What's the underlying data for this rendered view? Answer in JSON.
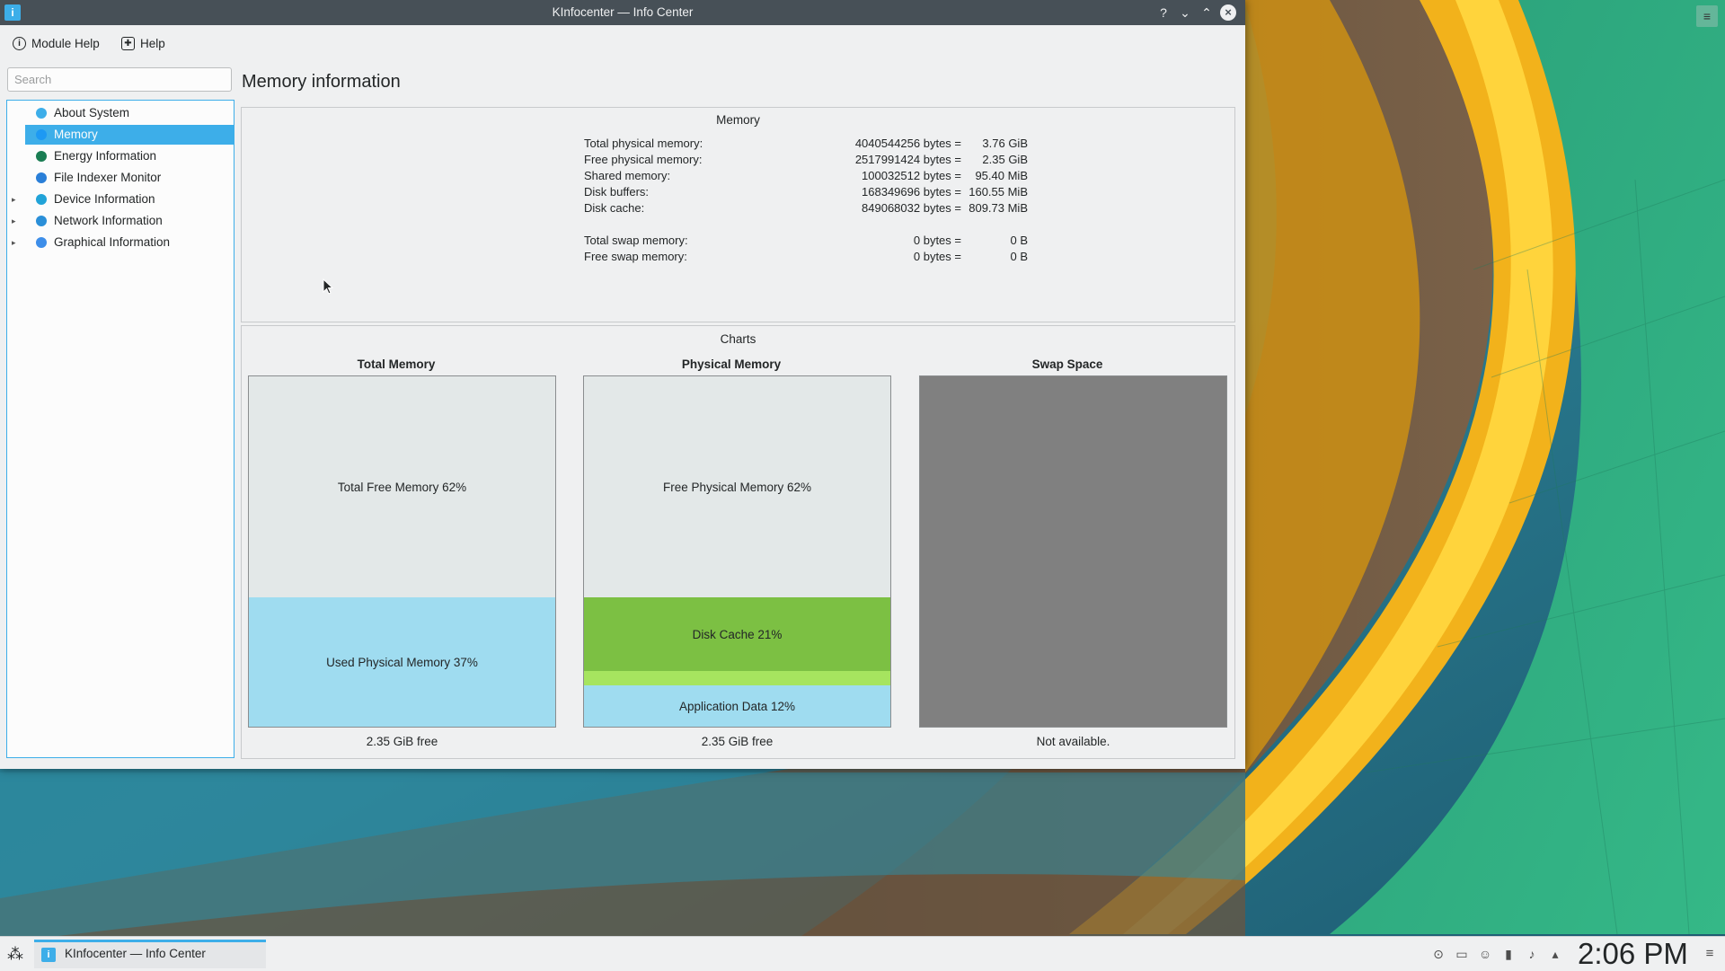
{
  "window": {
    "title": "KInfocenter — Info Center",
    "controls": {
      "help": "?",
      "minimize": "⌄",
      "maximize": "⌃",
      "close": "×"
    }
  },
  "toolbar": {
    "module_help_label": "Module Help",
    "help_label": "Help"
  },
  "sidebar": {
    "search_placeholder": "Search",
    "items": [
      {
        "label": "About System",
        "icon": "info-icon",
        "color": "#3daee9",
        "expandable": false,
        "selected": false
      },
      {
        "label": "Memory",
        "icon": "memory-icon",
        "color": "#1d99f3",
        "expandable": false,
        "selected": true
      },
      {
        "label": "Energy Information",
        "icon": "energy-icon",
        "color": "#1a7d53",
        "expandable": false,
        "selected": false
      },
      {
        "label": "File Indexer Monitor",
        "icon": "file-indexer-icon",
        "color": "#2a7fd8",
        "expandable": false,
        "selected": false
      },
      {
        "label": "Device Information",
        "icon": "device-icon",
        "color": "#21a3d8",
        "expandable": true,
        "selected": false
      },
      {
        "label": "Network Information",
        "icon": "network-icon",
        "color": "#2a8fd8",
        "expandable": true,
        "selected": false
      },
      {
        "label": "Graphical Information",
        "icon": "graphics-icon",
        "color": "#3d8ee9",
        "expandable": true,
        "selected": false
      }
    ]
  },
  "main": {
    "heading": "Memory information",
    "memory_group": {
      "title": "Memory",
      "rows": [
        {
          "label": "Total physical memory:",
          "bytes": "4040544256 bytes =",
          "human": "3.76 GiB"
        },
        {
          "label": "Free physical memory:",
          "bytes": "2517991424 bytes =",
          "human": "2.35 GiB"
        },
        {
          "label": "Shared memory:",
          "bytes": "100032512 bytes =",
          "human": "95.40 MiB"
        },
        {
          "label": "Disk buffers:",
          "bytes": "168349696 bytes =",
          "human": "160.55 MiB"
        },
        {
          "label": "Disk cache:",
          "bytes": "849068032 bytes =",
          "human": "809.73 MiB"
        }
      ],
      "swap_rows": [
        {
          "label": "Total swap memory:",
          "bytes": "0 bytes =",
          "human": "0 B"
        },
        {
          "label": "Free swap memory:",
          "bytes": "0 bytes =",
          "human": "0 B"
        }
      ]
    },
    "charts_group": {
      "title": "Charts",
      "charts": [
        {
          "title": "Total Memory",
          "caption": "2.35 GiB free",
          "segments": [
            {
              "label": "Total Free Memory 62%",
              "fraction": 0.63,
              "color": "#e3e8e8"
            },
            {
              "label": "Used Physical Memory 37%",
              "fraction": 0.37,
              "color": "#9fdcf0"
            }
          ]
        },
        {
          "title": "Physical Memory",
          "caption": "2.35 GiB free",
          "segments": [
            {
              "label": "Free Physical Memory 62%",
              "fraction": 0.63,
              "color": "#e3e8e8"
            },
            {
              "label": "Disk Cache 21%",
              "fraction": 0.21,
              "color": "#7cc043"
            },
            {
              "label": "",
              "fraction": 0.04,
              "color": "#a6e45f"
            },
            {
              "label": "Application Data 12%",
              "fraction": 0.12,
              "color": "#9fdcf0"
            }
          ]
        },
        {
          "title": "Swap Space",
          "caption": "Not available.",
          "segments": [
            {
              "label": "",
              "fraction": 1.0,
              "color": "#808080"
            }
          ]
        }
      ]
    }
  },
  "taskbar": {
    "task_label": "KInfocenter — Info Center",
    "clock": "2:06 PM",
    "tray_icons": [
      "updates-icon",
      "display-icon",
      "users-icon",
      "battery-icon",
      "volume-icon",
      "expand-tray-icon"
    ]
  },
  "colors": {
    "accent": "#3daee9",
    "titlebar": "#475057",
    "window_bg": "#eff0f1"
  }
}
